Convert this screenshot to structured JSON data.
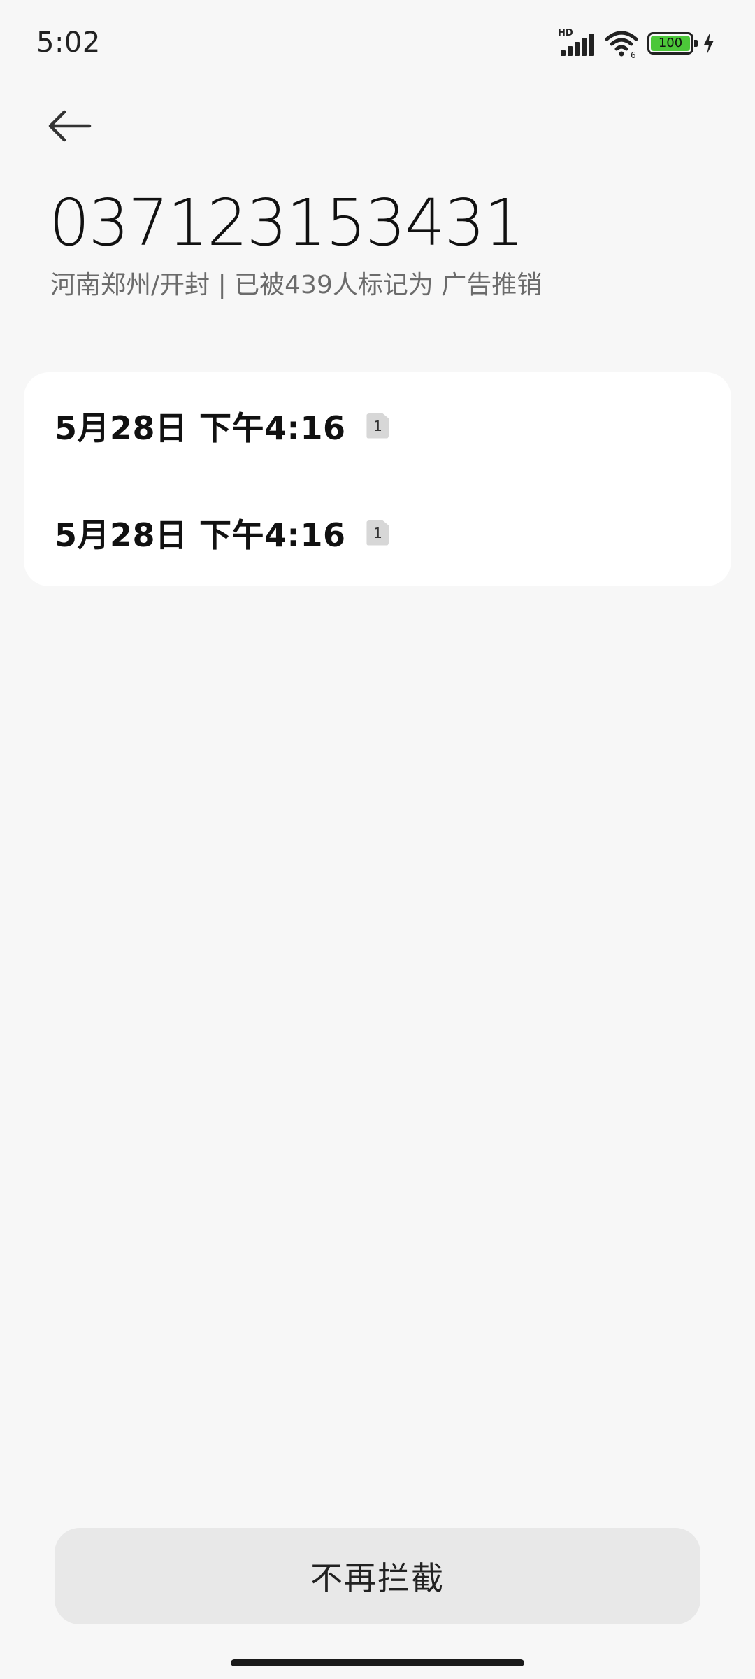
{
  "status_bar": {
    "time": "5:02",
    "network_label": "HD",
    "battery_level": "100",
    "battery_color": "#4cc739",
    "icons": [
      "signal-icon",
      "wifi-icon",
      "battery-icon",
      "charging-bolt-icon"
    ]
  },
  "header": {
    "back_icon": "back-arrow-icon",
    "phone_number": "037123153431",
    "info": "河南郑州/开封 | 已被439人标记为 广告推销"
  },
  "messages": [
    {
      "time": "5月28日 下午4:16",
      "sim": "1"
    },
    {
      "time": "5月28日 下午4:16",
      "sim": "1"
    }
  ],
  "actions": {
    "unblock_label": "不再拦截"
  }
}
